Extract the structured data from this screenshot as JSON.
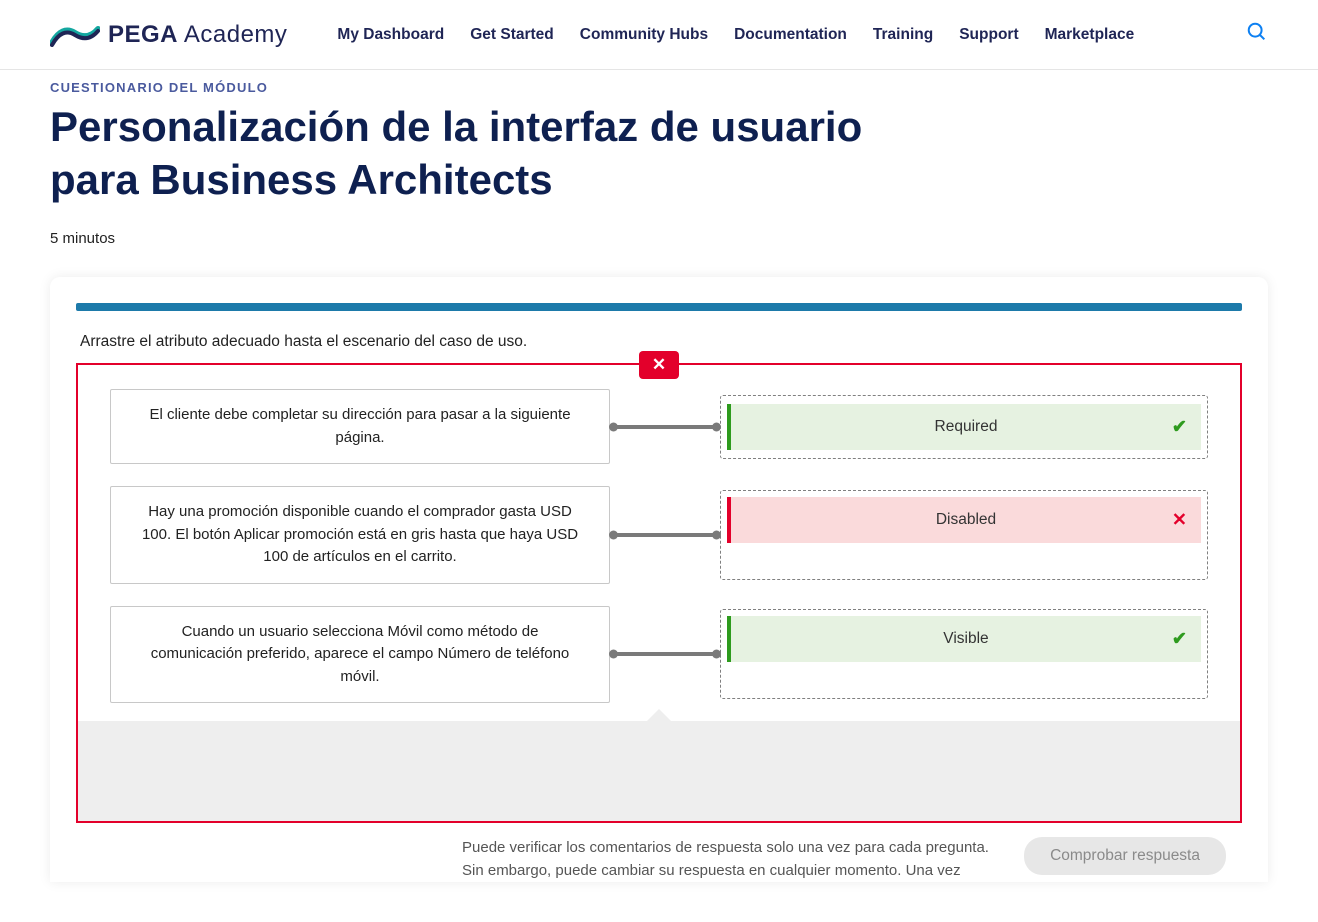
{
  "header": {
    "brand_strong": "PEGA",
    "brand_light": "Academy",
    "nav": [
      "My Dashboard",
      "Get Started",
      "Community Hubs",
      "Documentation",
      "Training",
      "Support",
      "Marketplace"
    ]
  },
  "page": {
    "eyebrow": "CUESTIONARIO DEL MÓDULO",
    "title": "Personalización de la interfaz de usuario para Business Architects",
    "duration": "5 minutos"
  },
  "quiz": {
    "question": "Arrastre el atributo adecuado hasta el escenario del caso de uso.",
    "rows": [
      {
        "scenario": "El cliente debe completar su dirección para pasar a la siguiente página.",
        "answer": "Required",
        "correct": true
      },
      {
        "scenario": "Hay una promoción disponible cuando el comprador gasta USD 100. El botón Aplicar promoción está en gris hasta que haya USD 100 de artículos en el carrito.",
        "answer": "Disabled",
        "correct": false
      },
      {
        "scenario": "Cuando un usuario selecciona Móvil como método de comunicación preferido, aparece el campo Número de teléfono móvil.",
        "answer": "Visible",
        "correct": true
      }
    ],
    "footer_text": "Puede verificar los comentarios de respuesta solo una vez para cada pregunta. Sin embargo, puede cambiar su respuesta en cualquier momento. Una vez",
    "check_label": "Comprobar respuesta"
  }
}
